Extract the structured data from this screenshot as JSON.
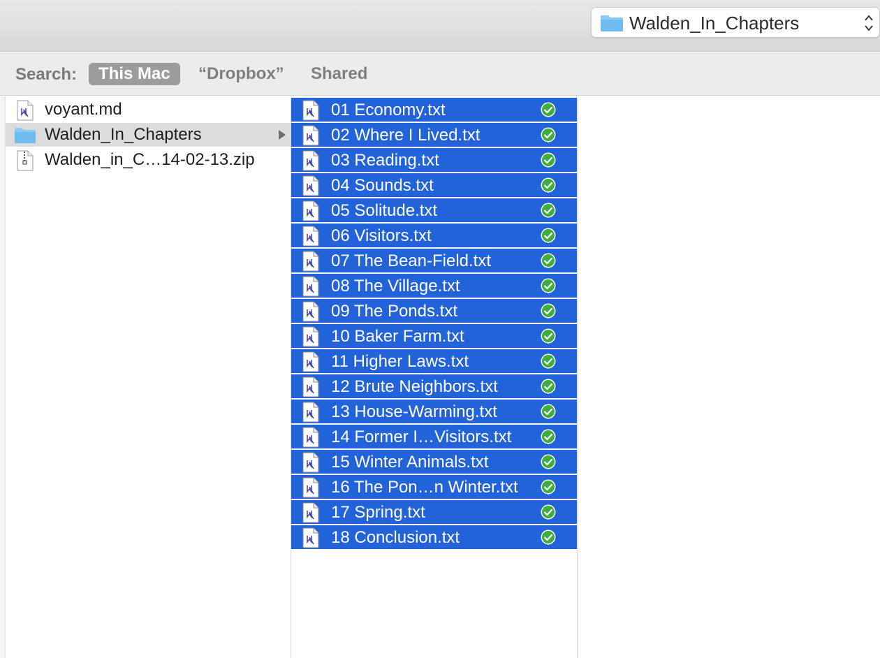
{
  "toolbar": {
    "location": "Walden_In_Chapters"
  },
  "search": {
    "label": "Search:",
    "scopes": [
      {
        "label": "This Mac",
        "active": true
      },
      {
        "label": "“Dropbox”",
        "active": false
      },
      {
        "label": "Shared",
        "active": false
      }
    ]
  },
  "column1": {
    "items": [
      {
        "name": "voyant.md",
        "icon": "text-document-icon"
      },
      {
        "name": "Walden_In_Chapters",
        "icon": "folder-icon",
        "selected": true
      },
      {
        "name": "Walden_in_C…14-02-13.zip",
        "icon": "zip-archive-icon"
      }
    ]
  },
  "column2": {
    "items": [
      {
        "name": "01 Economy.txt"
      },
      {
        "name": "02 Where I Lived.txt"
      },
      {
        "name": "03 Reading.txt"
      },
      {
        "name": "04 Sounds.txt"
      },
      {
        "name": "05 Solitude.txt"
      },
      {
        "name": "06 Visitors.txt"
      },
      {
        "name": "07 The Bean-Field.txt"
      },
      {
        "name": "08 The Village.txt"
      },
      {
        "name": "09 The Ponds.txt"
      },
      {
        "name": "10 Baker Farm.txt"
      },
      {
        "name": "11 Higher Laws.txt"
      },
      {
        "name": "12 Brute Neighbors.txt"
      },
      {
        "name": "13 House-Warming.txt"
      },
      {
        "name": "14 Former I…Visitors.txt"
      },
      {
        "name": "15 Winter Animals.txt"
      },
      {
        "name": "16 The Pon…n Winter.txt"
      },
      {
        "name": "17 Spring.txt"
      },
      {
        "name": "18 Conclusion.txt"
      }
    ]
  },
  "colors": {
    "selection": "#2263d9",
    "sync_check": "#3fae3f",
    "folder": "#7ec3f3"
  }
}
